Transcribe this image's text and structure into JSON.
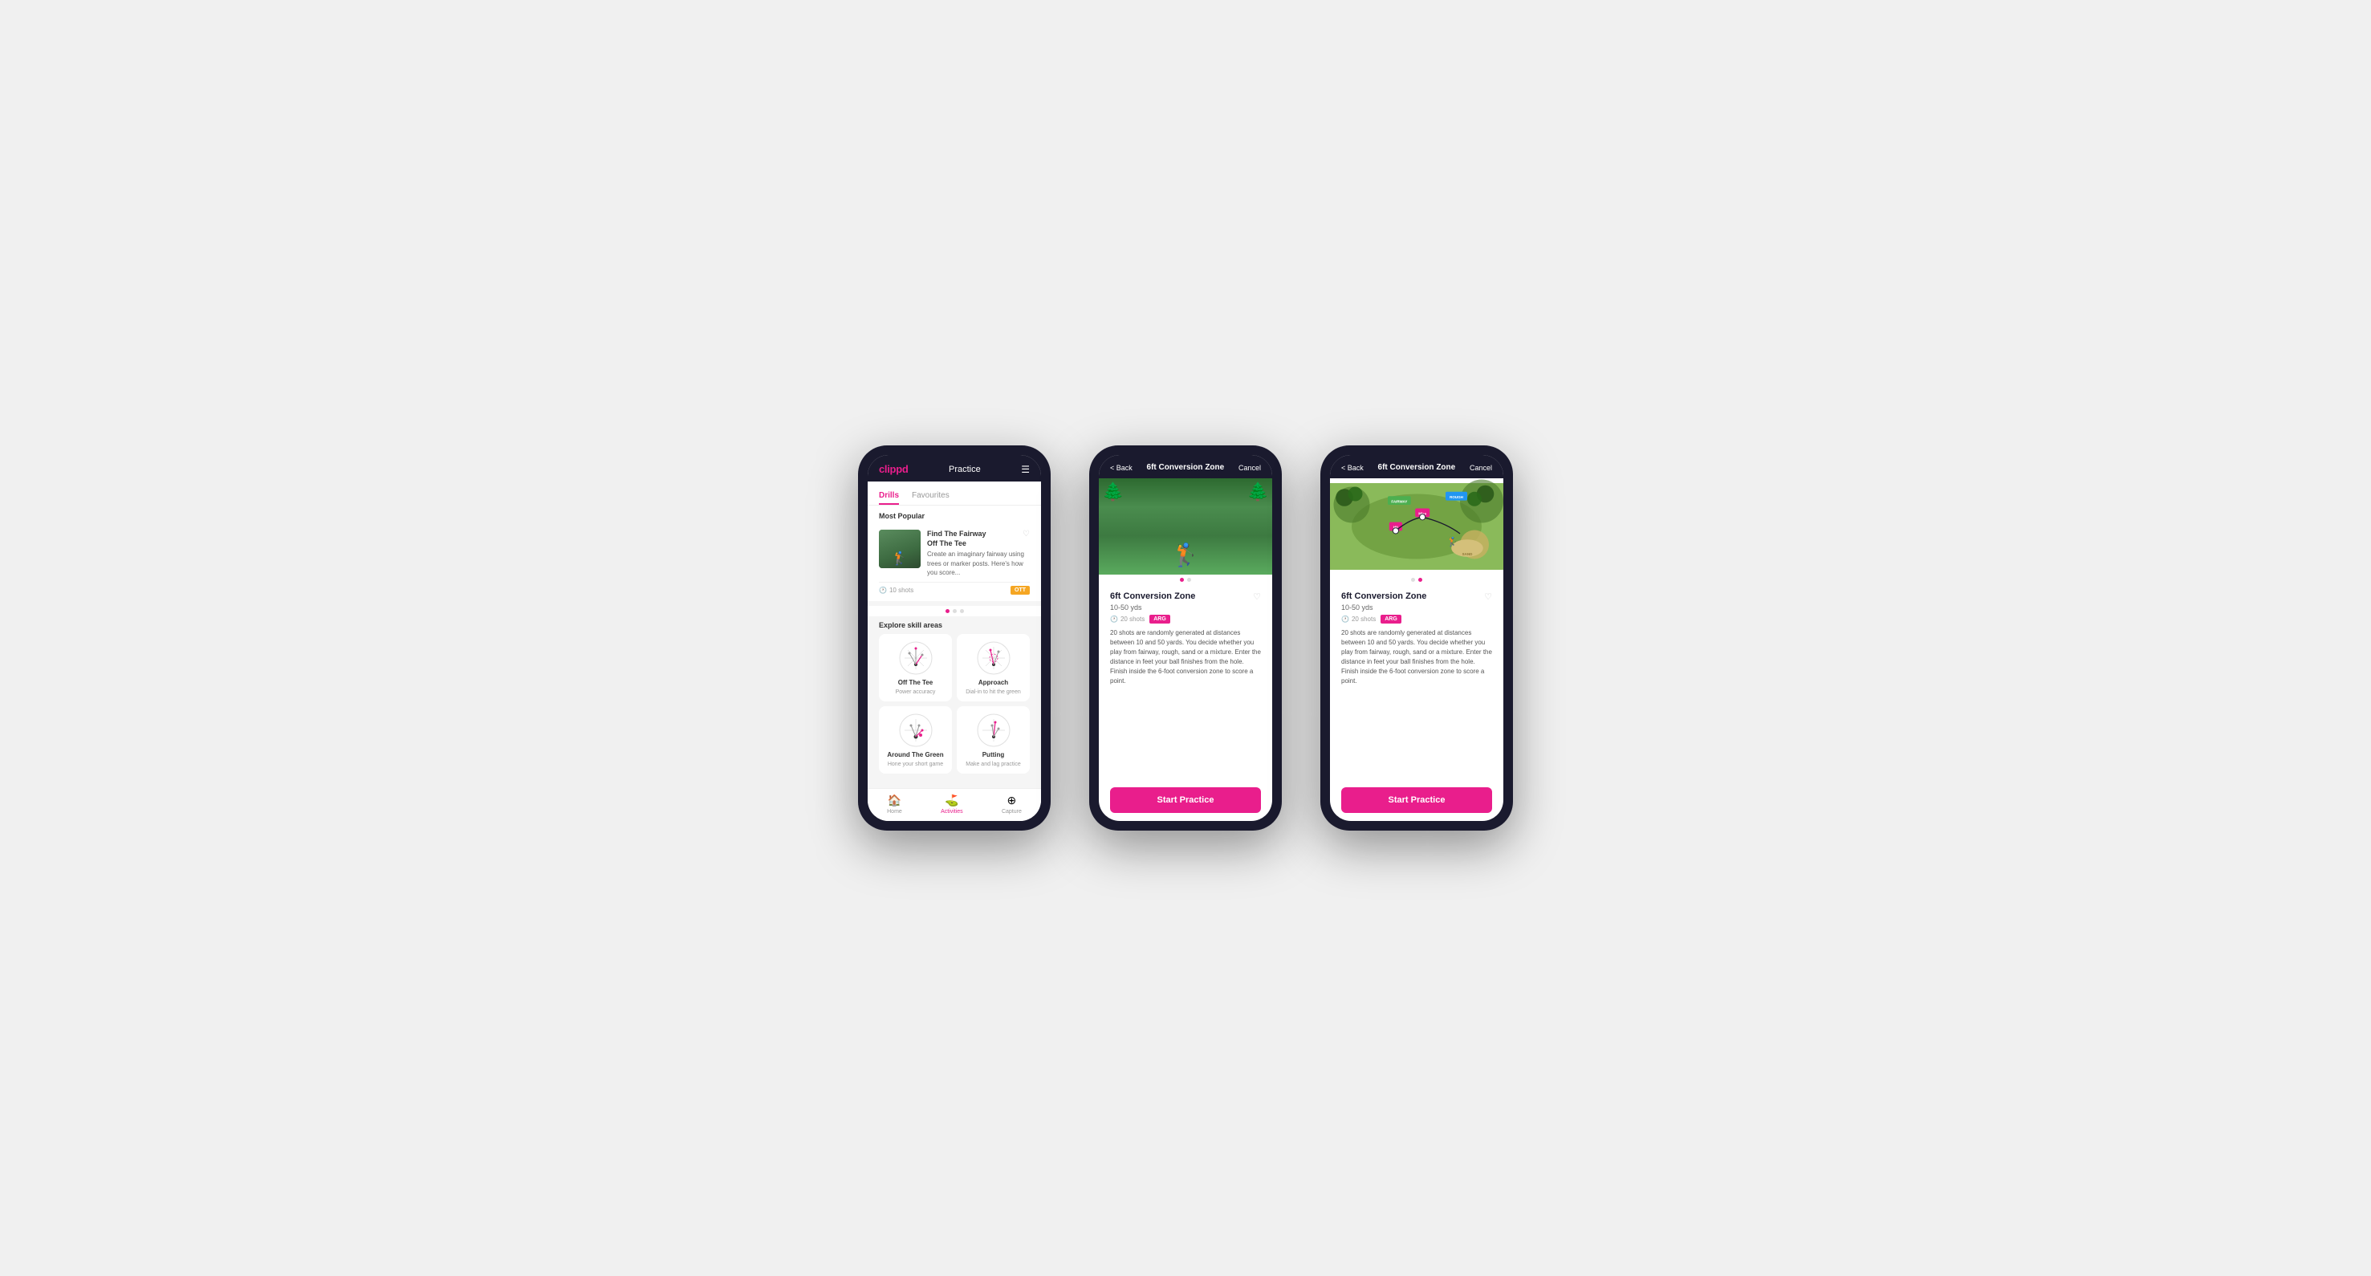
{
  "phone1": {
    "header": {
      "logo": "clippd",
      "title": "Practice",
      "menu_icon": "☰"
    },
    "tabs": [
      {
        "label": "Drills",
        "active": true
      },
      {
        "label": "Favourites",
        "active": false
      }
    ],
    "most_popular": {
      "section_title": "Most Popular",
      "card": {
        "title": "Find The Fairway",
        "subtitle": "Off The Tee",
        "description": "Create an imaginary fairway using trees or marker posts. Here's how you score...",
        "shots": "10 shots",
        "badge": "OTT"
      },
      "dots": [
        true,
        false,
        false
      ]
    },
    "explore": {
      "section_title": "Explore skill areas",
      "skills": [
        {
          "name": "Off The Tee",
          "desc": "Power accuracy"
        },
        {
          "name": "Approach",
          "desc": "Dial-in to hit the green"
        },
        {
          "name": "Around The Green",
          "desc": "Hone your short game"
        },
        {
          "name": "Putting",
          "desc": "Make and lag practice"
        }
      ]
    },
    "bottom_nav": [
      {
        "label": "Home",
        "icon": "🏠",
        "active": false
      },
      {
        "label": "Activities",
        "icon": "⛳",
        "active": true
      },
      {
        "label": "Capture",
        "icon": "⊕",
        "active": false
      }
    ]
  },
  "phone2": {
    "header": {
      "back": "< Back",
      "title": "6ft Conversion Zone",
      "cancel": "Cancel"
    },
    "drill": {
      "title": "6ft Conversion Zone",
      "yards": "10-50 yds",
      "shots": "20 shots",
      "badge": "ARG",
      "description": "20 shots are randomly generated at distances between 10 and 50 yards. You decide whether you play from fairway, rough, sand or a mixture. Enter the distance in feet your ball finishes from the hole. Finish inside the 6-foot conversion zone to score a point.",
      "cta": "Start Practice"
    },
    "dots": [
      true,
      false
    ]
  },
  "phone3": {
    "header": {
      "back": "< Back",
      "title": "6ft Conversion Zone",
      "cancel": "Cancel"
    },
    "drill": {
      "title": "6ft Conversion Zone",
      "yards": "10-50 yds",
      "shots": "20 shots",
      "badge": "ARG",
      "description": "20 shots are randomly generated at distances between 10 and 50 yards. You decide whether you play from fairway, rough, sand or a mixture. Enter the distance in feet your ball finishes from the hole. Finish inside the 6-foot conversion zone to score a point.",
      "cta": "Start Practice"
    },
    "dots": [
      false,
      true
    ]
  }
}
